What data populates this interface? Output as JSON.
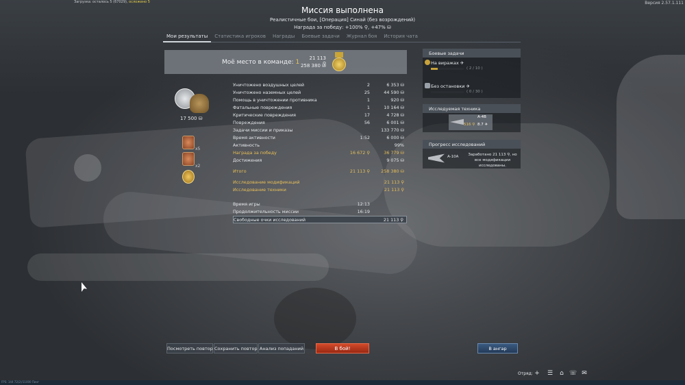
{
  "header": {
    "loading_text": "Загрузка: осталось 5 (67029),",
    "loading_ok": "осложено 5",
    "version": "Версия 2.57.1.111",
    "title": "Миссия выполнена",
    "subtitle": "Реалистичные бои, [Операция] Синай (без возрождений)",
    "reward": "Награда за победу: +100% ⚲, +47% ⛁"
  },
  "tabs": [
    {
      "label": "Мои результаты",
      "active": true
    },
    {
      "label": "Статистика игроков"
    },
    {
      "label": "Награды"
    },
    {
      "label": "Боевые задачи"
    },
    {
      "label": "Журнал боя"
    },
    {
      "label": "История чата"
    }
  ],
  "place": {
    "label": "Моё место в команде:",
    "number": "1",
    "rp": "21 113 ⚲",
    "sl": "258 380 ⛁"
  },
  "loot": {
    "value": "17 500 ⛁"
  },
  "awards": [
    {
      "mult": "x5"
    },
    {
      "mult": "x2"
    }
  ],
  "stats": [
    {
      "label": "Уничтожено воздушных целей",
      "c1": "2",
      "c2": "6 353 ⛁"
    },
    {
      "label": "Уничтожено наземных целей",
      "c1": "25",
      "c2": "44 590 ⛁"
    },
    {
      "label": "Помощь в уничтожении противника",
      "c1": "1",
      "c2": "920 ⛁"
    },
    {
      "label": "Фатальные повреждения",
      "c1": "1",
      "c2": "10 164 ⛁"
    },
    {
      "label": "Критические повреждения",
      "c1": "17",
      "c2": "4 728 ⛁"
    },
    {
      "label": "Повреждения",
      "c1": "56",
      "c2": "6 001 ⛁"
    },
    {
      "label": "Задачи миссии и приказы",
      "c1": "",
      "c2": "133 770 ⛁"
    },
    {
      "label": "Время активности",
      "c1": "1:52",
      "c2": "6 000 ⛁"
    },
    {
      "label": "Активность",
      "c1": "",
      "c2": "99%"
    },
    {
      "label": "Награда за победу",
      "c1": "16 672 ⚲",
      "c2": "36 779 ⛁",
      "style": "gold"
    },
    {
      "label": "Достижения",
      "c1": "",
      "c2": "9 075 ⛁"
    }
  ],
  "totals": [
    {
      "label": "Итого",
      "c1": "21 113 ⚲",
      "c2": "258 380 ⛁"
    },
    {
      "label": "Исследование модификаций",
      "c1": "",
      "c2": "21 113 ⚲"
    },
    {
      "label": "Исследование техники",
      "c1": "",
      "c2": "21 113 ⚲"
    }
  ],
  "times": [
    {
      "label": "Время игры",
      "c1": "12:13",
      "c2": ""
    },
    {
      "label": "Продолжительность миссии",
      "c1": "16:19",
      "c2": ""
    },
    {
      "label": "Свободные очки исследований",
      "c1": "",
      "c2": "21 113 ⚲"
    }
  ],
  "tasks_panel": {
    "title": "Боевые задачи",
    "tasks": [
      {
        "name": "На виражах ✈",
        "progress": "( 2 / 10 )",
        "fraction": 0.2
      },
      {
        "name": "Без остановки ✈",
        "progress": "( 0 / 30 )",
        "fraction": 0.0
      }
    ]
  },
  "research_vehicle": {
    "title": "Исследуемая техника",
    "name": "A-4B",
    "rp": "516 ⚲",
    "br": "8.7 ✈"
  },
  "research_progress": {
    "title": "Прогресс исследований",
    "vehicle": "A-10A",
    "desc": "Заработано 21 113 ⚲, но все модификации исследованы."
  },
  "buttons": {
    "replay": "Посмотреть повтор",
    "save": "Сохранить повтор",
    "analysis": "Анализ попаданий",
    "battle": "В бой!",
    "hangar": "В ангар"
  },
  "squad": {
    "label": "Отряд:"
  },
  "bottom": {
    "fps": "FPS: 144    72(2)/11000 Пинг"
  }
}
